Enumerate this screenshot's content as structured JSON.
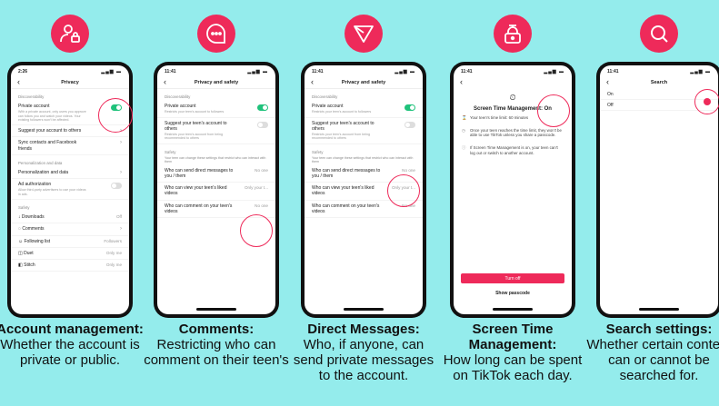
{
  "colors": {
    "background": "#94ecec",
    "accent": "#ee2a5a",
    "toggle_on": "#20c27b"
  },
  "panels": [
    {
      "icon": "person-lock-icon",
      "phone": {
        "time": "2:26",
        "title": "Privacy",
        "section1": "Discoverability",
        "private_account": "Private account",
        "private_desc": "With a private account, only users you approve can follow you and watch your videos. Your existing followers won't be affected.",
        "suggest": "Suggest your account to others",
        "sync": "Sync contacts and Facebook friends",
        "section2": "Personalization and data",
        "personalization": "Personalization and data",
        "ad_auth": "Ad authorization",
        "ad_desc": "Allow third-party advertisers to use your videos in ads.",
        "section3": "Safety",
        "downloads": "Downloads",
        "downloads_val": "Off",
        "comments": "Comments",
        "following": "Following list",
        "following_val": "Followers",
        "duet": "Duet",
        "duet_val": "Only me",
        "stitch": "Stitch",
        "stitch_val": "Only me"
      },
      "caption_bold": "Account management:",
      "caption": "Whether the account is private or public."
    },
    {
      "icon": "chat-bubble-icon",
      "phone": {
        "time": "11:41",
        "title": "Privacy and safety",
        "section1": "Discoverability",
        "private_account": "Private account",
        "private_desc": "Restricts your teen's account to followers",
        "suggest": "Suggest your teen's account to others",
        "suggest_desc": "Restricts your teen's account from being recommended to others",
        "section2": "Safety",
        "safety_desc": "Your teen can change these settings that restrict who can interact with them",
        "dm": "Who can send direct messages to you / them",
        "dm_val": "No one",
        "liked": "Who can view your teen's liked videos",
        "liked_val": "Only your t...",
        "comment": "Who can comment on your teen's videos",
        "comment_val": "No one"
      },
      "caption_bold": "Comments:",
      "caption": "Restricting who can comment on their teen's"
    },
    {
      "icon": "send-arrow-icon",
      "phone": {
        "time": "11:41",
        "title": "Privacy and safety",
        "section1": "Discoverability",
        "private_account": "Private account",
        "private_desc": "Restricts your teen's account to followers",
        "suggest": "Suggest your teen's account to others",
        "suggest_desc": "Restricts your teen's account from being recommended to others",
        "section2": "Safety",
        "safety_desc": "Your teen can change these settings that restrict who can interact with them",
        "dm": "Who can send direct messages to you / them",
        "dm_val": "No one",
        "liked": "Who can view your teen's liked videos",
        "liked_val": "Only your t...",
        "comment": "Who can comment on your teen's videos",
        "comment_val": "No one"
      },
      "caption_bold": "Direct Messages:",
      "caption": "Who, if anyone, can send private messages to the account."
    },
    {
      "icon": "timer-lock-icon",
      "phone": {
        "time": "11:41",
        "title": "Screen Time Management: On",
        "item1": "Your teen's time limit: 60 minutes",
        "item2": "Once your teen reaches the time limit, they won't be able to use TikTok unless you share a passcode.",
        "item3": "If Screen Time Management is on, your teen can't log out or switch to another account.",
        "turn_off": "Turn off",
        "show_passcode": "Show passcode"
      },
      "caption_bold": "Screen Time Management:",
      "caption": "How long can be spent on TikTok each day."
    },
    {
      "icon": "search-icon",
      "phone": {
        "time": "11:41",
        "title": "Search",
        "field": "On",
        "row": "Off"
      },
      "caption_bold": "Search settings:",
      "caption": "Whether certain content can or cannot be searched for."
    }
  ]
}
